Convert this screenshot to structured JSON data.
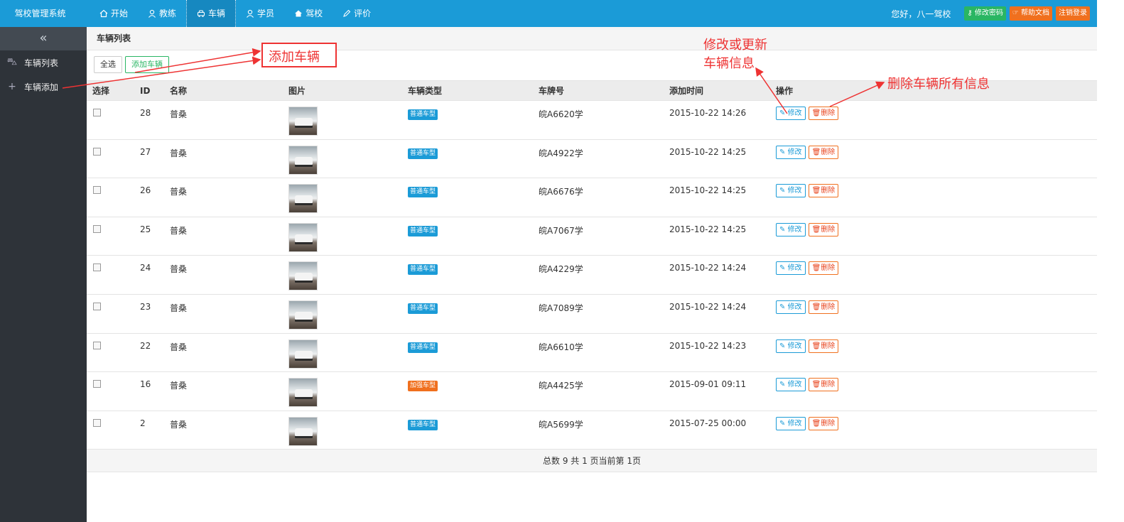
{
  "app": {
    "title": "驾校管理系统"
  },
  "nav": [
    {
      "label": "开始",
      "icon": "home-icon"
    },
    {
      "label": "教练",
      "icon": "user-icon"
    },
    {
      "label": "车辆",
      "icon": "car-icon"
    },
    {
      "label": "学员",
      "icon": "user-icon"
    },
    {
      "label": "驾校",
      "icon": "home-icon"
    },
    {
      "label": "评价",
      "icon": "pen-icon"
    }
  ],
  "header": {
    "greeting": "您好，八一驾校",
    "change_password": "修改密码",
    "help_doc": "帮助文档",
    "logout": "注销登录"
  },
  "sidebar": {
    "collapse_glyph": "«",
    "items": [
      {
        "label": "车辆列表",
        "icon": "car-icon"
      },
      {
        "label": "车辆添加",
        "icon": "plus-icon"
      }
    ]
  },
  "breadcrumb": "车辆列表",
  "toolbar": {
    "select_all": "全选",
    "add_vehicle": "添加车辆"
  },
  "table": {
    "headers": [
      "选择",
      "ID",
      "名称",
      "图片",
      "车辆类型",
      "车牌号",
      "添加时间",
      "操作"
    ],
    "edit_label": "修改",
    "delete_label": "删除",
    "rows": [
      {
        "id": "28",
        "name": "普桑",
        "type": "普通车型",
        "type_color": "#1b9bd7",
        "plate": "皖A6620学",
        "time": "2015-10-22 14:26"
      },
      {
        "id": "27",
        "name": "普桑",
        "type": "普通车型",
        "type_color": "#1b9bd7",
        "plate": "皖A4922学",
        "time": "2015-10-22 14:25"
      },
      {
        "id": "26",
        "name": "普桑",
        "type": "普通车型",
        "type_color": "#1b9bd7",
        "plate": "皖A6676学",
        "time": "2015-10-22 14:25"
      },
      {
        "id": "25",
        "name": "普桑",
        "type": "普通车型",
        "type_color": "#1b9bd7",
        "plate": "皖A7067学",
        "time": "2015-10-22 14:25"
      },
      {
        "id": "24",
        "name": "普桑",
        "type": "普通车型",
        "type_color": "#1b9bd7",
        "plate": "皖A4229学",
        "time": "2015-10-22 14:24"
      },
      {
        "id": "23",
        "name": "普桑",
        "type": "普通车型",
        "type_color": "#1b9bd7",
        "plate": "皖A7089学",
        "time": "2015-10-22 14:24"
      },
      {
        "id": "22",
        "name": "普桑",
        "type": "普通车型",
        "type_color": "#1b9bd7",
        "plate": "皖A6610学",
        "time": "2015-10-22 14:23"
      },
      {
        "id": "16",
        "name": "普桑",
        "type": "加强车型",
        "type_color": "#f0701e",
        "plate": "皖A4425学",
        "time": "2015-09-01 09:11"
      },
      {
        "id": "2",
        "name": "普桑",
        "type": "普通车型",
        "type_color": "#1b9bd7",
        "plate": "皖A5699学",
        "time": "2015-07-25 00:00"
      }
    ]
  },
  "pager": "总数 9 共 1 页当前第 1页",
  "annotations": {
    "add": "添加车辆",
    "edit_line1": "修改或更新",
    "edit_line2": "车辆信息",
    "delete": "删除车辆所有信息"
  }
}
